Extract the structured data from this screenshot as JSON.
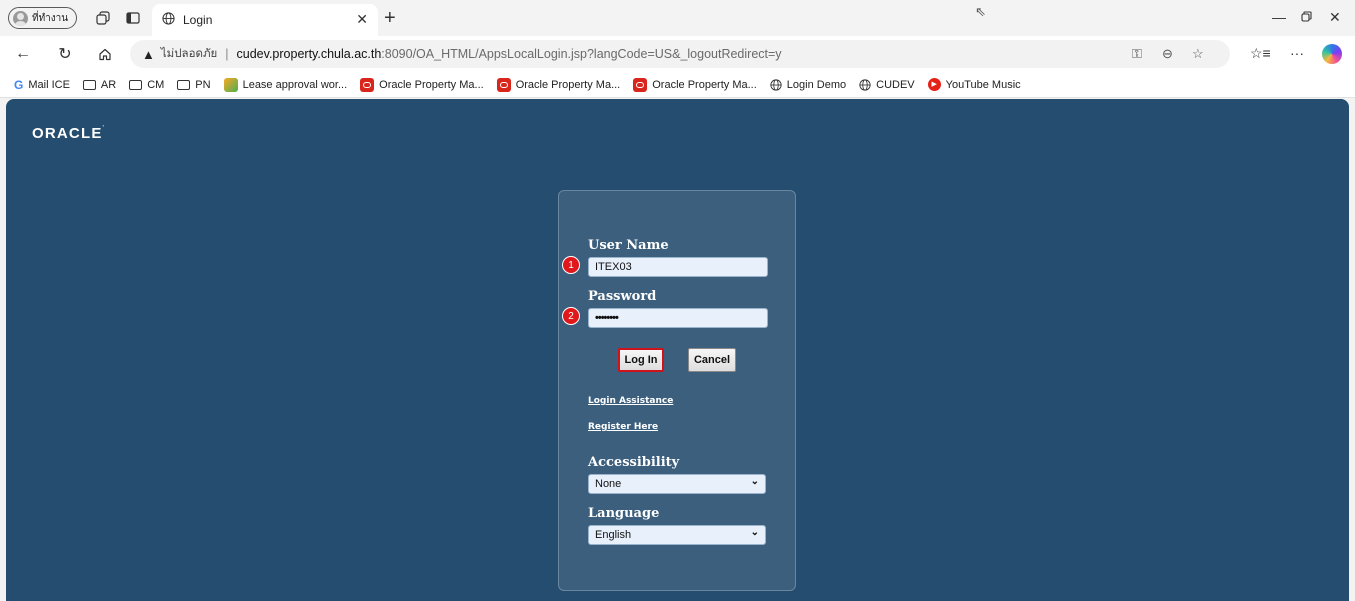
{
  "browser": {
    "profile_label": "ที่ทำงาน",
    "tab_title": "Login",
    "address": {
      "security_label": "ไม่ปลอดภัย",
      "url_host": "cudev.property.chula.ac.th",
      "url_rest": ":8090/OA_HTML/AppsLocalLogin.jsp?langCode=US&_logoutRedirect=y"
    },
    "bookmarks": [
      {
        "label": "Mail ICE",
        "icon": "google-icon"
      },
      {
        "label": "AR",
        "icon": "folder-icon"
      },
      {
        "label": "CM",
        "icon": "folder-icon"
      },
      {
        "label": "PN",
        "icon": "folder-icon"
      },
      {
        "label": "Lease approval wor...",
        "icon": "app-icon"
      },
      {
        "label": "Oracle Property Ma...",
        "icon": "oracle-icon"
      },
      {
        "label": "Oracle Property Ma...",
        "icon": "oracle-icon"
      },
      {
        "label": "Oracle Property Ma...",
        "icon": "oracle-icon"
      },
      {
        "label": "Login Demo",
        "icon": "globe-icon"
      },
      {
        "label": "CUDEV",
        "icon": "globe-icon"
      },
      {
        "label": "YouTube Music",
        "icon": "youtube-music-icon"
      }
    ]
  },
  "page": {
    "logo_text": "ORACLE",
    "login": {
      "username_label": "User Name",
      "username_value": "ITEX03",
      "password_label": "Password",
      "password_value": "••••••••",
      "login_button": "Log In",
      "cancel_button": "Cancel",
      "assistance_link": "Login Assistance",
      "register_link": "Register Here",
      "accessibility_label": "Accessibility",
      "accessibility_value": "None",
      "language_label": "Language",
      "language_value": "English",
      "step_badges": [
        "1",
        "2"
      ]
    },
    "colors": {
      "background": "#244d6f",
      "panel": "#3c5f7d",
      "badge": "#e0181b",
      "login_highlight": "#d0121b"
    }
  }
}
